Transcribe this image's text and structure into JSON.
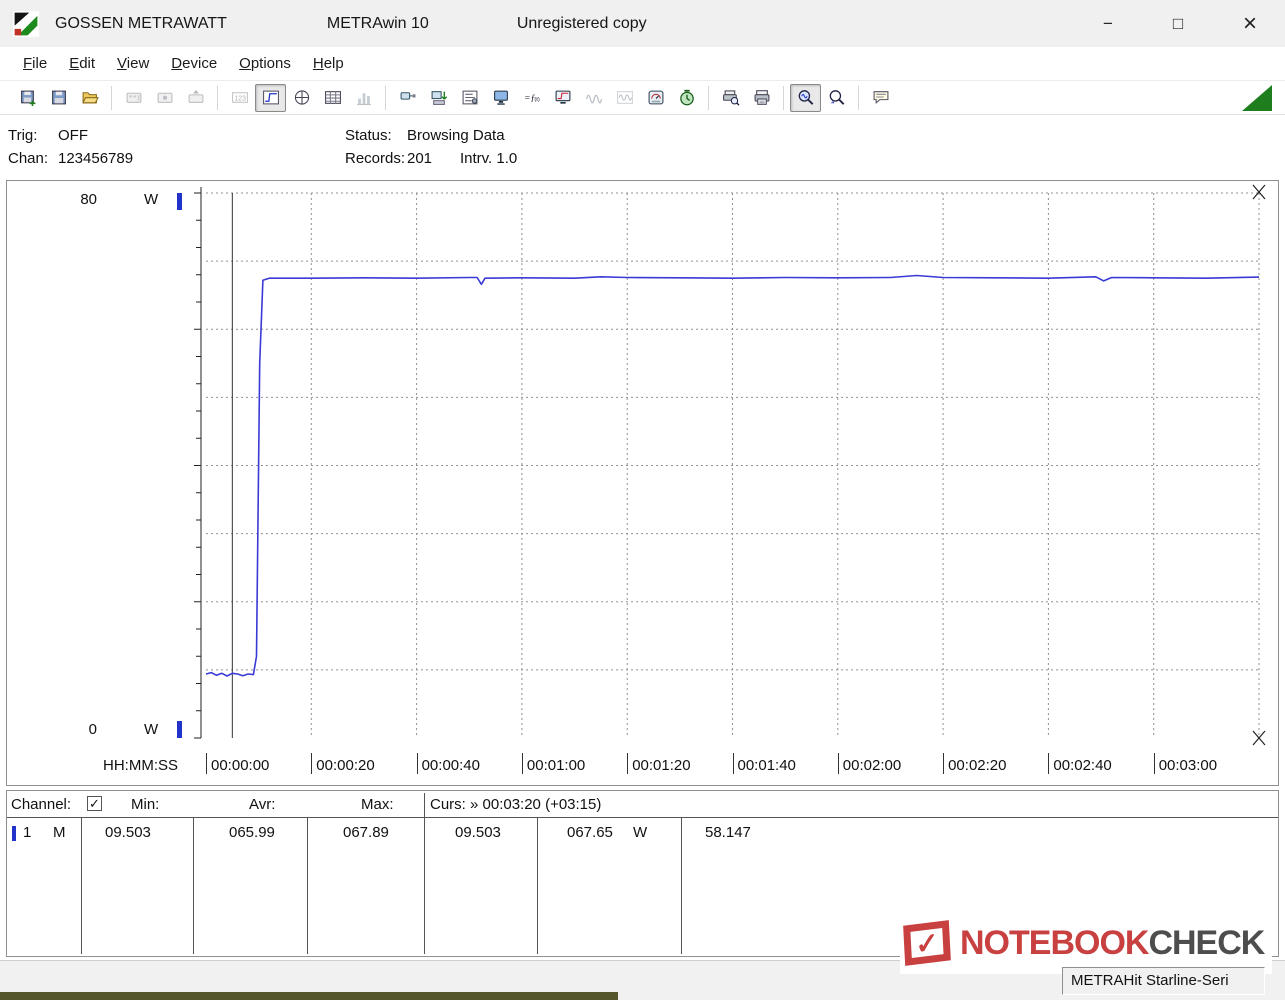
{
  "window": {
    "brand": "GOSSEN METRAWATT",
    "app": "METRAwin 10",
    "note": "Unregistered copy",
    "controls": {
      "minimize": "−",
      "maximize": "□",
      "close": "×"
    }
  },
  "menu": {
    "items": [
      "File",
      "Edit",
      "View",
      "Device",
      "Options",
      "Help"
    ]
  },
  "toolbar": {
    "groups": [
      [
        {
          "name": "open-data",
          "state": "normal"
        },
        {
          "name": "save-file",
          "state": "normal"
        },
        {
          "name": "open-folder",
          "state": "normal"
        }
      ],
      [
        {
          "name": "card-export",
          "state": "disabled"
        },
        {
          "name": "card-snapshot",
          "state": "disabled"
        },
        {
          "name": "card-eject",
          "state": "disabled"
        }
      ],
      [
        {
          "name": "numeric-view",
          "state": "disabled"
        },
        {
          "name": "trend-view",
          "state": "active"
        },
        {
          "name": "scope-view",
          "state": "normal"
        },
        {
          "name": "table-view",
          "state": "normal"
        },
        {
          "name": "bargraph-view",
          "state": "disabled"
        }
      ],
      [
        {
          "name": "device-connect",
          "state": "normal"
        },
        {
          "name": "device-download",
          "state": "normal"
        },
        {
          "name": "device-config",
          "state": "normal"
        },
        {
          "name": "device-monitor",
          "state": "normal"
        },
        {
          "name": "formula",
          "state": "normal"
        },
        {
          "name": "pc-display",
          "state": "normal"
        },
        {
          "name": "waveform-a",
          "state": "disabled"
        },
        {
          "name": "waveform-b",
          "state": "disabled"
        },
        {
          "name": "multimeter",
          "state": "normal"
        },
        {
          "name": "timer",
          "state": "normal"
        }
      ],
      [
        {
          "name": "print-preview",
          "state": "normal"
        },
        {
          "name": "print",
          "state": "normal"
        }
      ],
      [
        {
          "name": "zoom-mode",
          "state": "active"
        },
        {
          "name": "zoom-pan",
          "state": "normal"
        }
      ],
      [
        {
          "name": "annotation",
          "state": "normal"
        }
      ]
    ]
  },
  "status_panel": {
    "trig_label": "Trig:",
    "trig_value": "OFF",
    "chan_label": "Chan:",
    "chan_value": "123456789",
    "status_label": "Status:",
    "status_value": "Browsing Data",
    "records_label": "Records:",
    "records_value": "201",
    "intrv": "Intrv. 1.0"
  },
  "chart_data": {
    "type": "line",
    "unit": "W",
    "y_top_label": "80",
    "y_bottom_label": "0",
    "ylim": [
      0,
      80
    ],
    "x_axis_label": "HH:MM:SS",
    "x_range_s": [
      0,
      200
    ],
    "x_tick_interval_s": 20,
    "x_ticks": [
      "00:00:00",
      "00:00:20",
      "00:00:40",
      "00:01:00",
      "00:01:20",
      "00:01:40",
      "00:02:00",
      "00:02:20",
      "00:02:40",
      "00:03:00"
    ],
    "grid": {
      "y_step": 10,
      "y_tick_step": 4,
      "style": "dashed"
    },
    "cursor1_s": 5,
    "cursor2_s": 200,
    "series": [
      {
        "name": "Channel 1",
        "color": "#3a3ad6",
        "points_t_s": [
          0,
          1,
          2,
          3,
          4,
          5,
          6,
          7,
          8,
          9,
          9.6,
          10.2,
          10.8,
          12,
          20,
          30,
          40,
          50,
          51.5,
          52.3,
          53,
          60,
          70,
          75,
          80,
          90,
          100,
          110,
          120,
          130,
          135,
          140,
          150,
          160,
          169,
          170.5,
          172,
          180,
          190,
          200
        ],
        "points_w": [
          9.4,
          9.6,
          9.2,
          9.5,
          9.1,
          9.503,
          9.4,
          9.15,
          9.4,
          9.3,
          12,
          55,
          67.2,
          67.5,
          67.5,
          67.55,
          67.5,
          67.6,
          67.6,
          66.6,
          67.5,
          67.55,
          67.5,
          67.7,
          67.6,
          67.55,
          67.5,
          67.6,
          67.55,
          67.6,
          67.89,
          67.6,
          67.55,
          67.5,
          67.7,
          67.1,
          67.6,
          67.55,
          67.5,
          67.65
        ]
      }
    ]
  },
  "table": {
    "header": {
      "channel": "Channel:",
      "checkbox_glyph": "✓",
      "min": "Min:",
      "avr": "Avr:",
      "max": "Max:",
      "curs": "Curs: » 00:03:20 (+03:15)"
    },
    "row": {
      "channel": "1",
      "mode": "M",
      "min": "09.503",
      "avr": "065.99",
      "max": "067.89",
      "cursor1": "09.503",
      "cursor2": "067.65",
      "unit": "W",
      "delta": "58.147"
    }
  },
  "statusbar": {
    "device": "METRAHit Starline-Seri"
  },
  "watermark": {
    "primary": "NOTEBOOK",
    "secondary": "CHECK",
    "check_glyph": "✓"
  },
  "colors": {
    "series": "#3a3ad6",
    "channel_marker": "#2233cc",
    "toolbar_triangle": "#1e7e1e",
    "watermark_red": "#c84040",
    "watermark_gray": "#4d4d4d"
  }
}
